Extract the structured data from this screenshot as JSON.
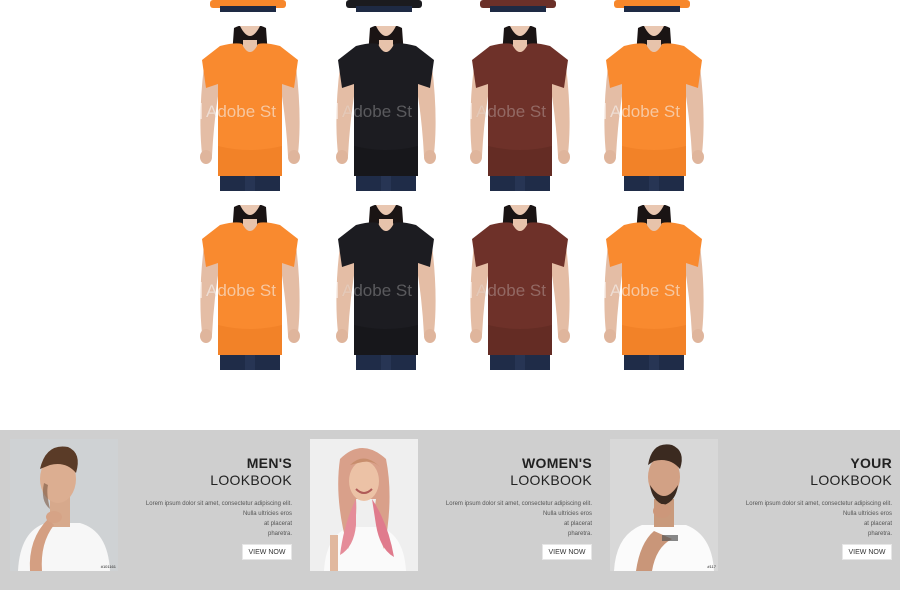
{
  "products": {
    "watermark_text": "Adobe St",
    "top_row_colors": [
      "#f7872b",
      "#1b1b1f",
      "#6b3029",
      "#f7872b"
    ],
    "rows": [
      {
        "items": [
          {
            "name": "orange-tee",
            "color": "#f98a2f"
          },
          {
            "name": "black-tee",
            "color": "#1c1c21"
          },
          {
            "name": "maroon-tee",
            "color": "#6e3129"
          },
          {
            "name": "orange-tee",
            "color": "#f98a2f"
          }
        ]
      },
      {
        "items": [
          {
            "name": "orange-tee",
            "color": "#f98a2f"
          },
          {
            "name": "black-tee",
            "color": "#1c1c21"
          },
          {
            "name": "maroon-tee",
            "color": "#6e3129"
          },
          {
            "name": "orange-tee",
            "color": "#f98a2f"
          }
        ]
      }
    ]
  },
  "lookbooks": [
    {
      "title_bold": "MEN'S",
      "title": "LOOKBOOK",
      "text_lines": [
        "Lorem ipsum dolor sit amet, consectetur adipiscing elit.",
        "Nulla ultricies eros",
        "at placerat",
        "pharetra."
      ],
      "button": "VIEW NOW",
      "tag": "#101161",
      "image": "man-white-tee-photo"
    },
    {
      "title_bold": "WOMEN'S",
      "title": "LOOKBOOK",
      "text_lines": [
        "Lorem ipsum dolor sit amet, consectetur adipiscing elit.",
        "Nulla ultricies eros",
        "at placerat",
        "pharetra."
      ],
      "button": "VIEW NOW",
      "tag": "",
      "image": "woman-pink-hair-photo"
    },
    {
      "title_bold": "YOUR",
      "title": "LOOKBOOK",
      "text_lines": [
        "Lorem ipsum dolor sit amet, consectetur adipiscing elit.",
        "Nulla ultricies eros",
        "at placerat",
        "pharetra."
      ],
      "button": "VIEW NOW",
      "tag": "#117",
      "image": "bearded-man-photo"
    }
  ],
  "colors": {
    "band_bg": "#cfcfcf",
    "title": "#222222"
  }
}
